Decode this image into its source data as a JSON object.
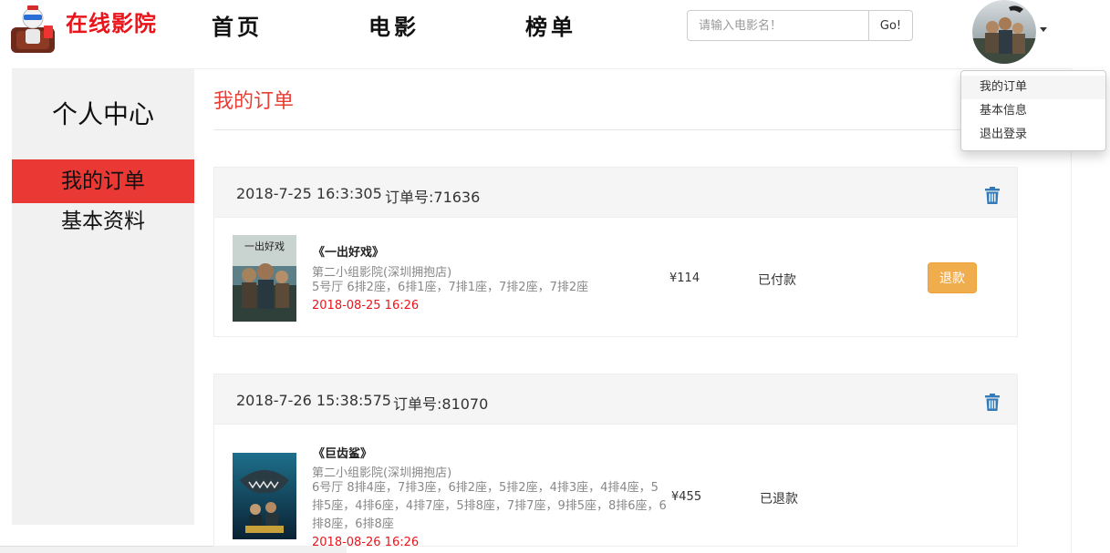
{
  "header": {
    "site_name": "在线影院",
    "nav": [
      "首页",
      "电影",
      "榜单"
    ],
    "search": {
      "placeholder": "请输入电影名！",
      "value": "",
      "button_label": "Go!"
    }
  },
  "user_menu": {
    "items": [
      "我的订单",
      "基本信息",
      "退出登录"
    ],
    "active_index": 0
  },
  "sidebar": {
    "title": "个人中心",
    "items": [
      "我的订单",
      "基本资料"
    ],
    "active_index": 0
  },
  "main": {
    "heading": "我的订单",
    "orders": [
      {
        "created": "2018-7-25 16:3:305",
        "order_no": "订单号:71636",
        "title": "《一出好戏》",
        "cinema": "第二小组影院(深圳拥抱店)",
        "seats": "5号厅 6排2座，6排1座，7排1座，7排2座，7排2座",
        "showtime": "2018-08-25 16:26",
        "price": "¥114",
        "status": "已付款",
        "action_label": "退款"
      },
      {
        "created": "2018-7-26 15:38:575",
        "order_no": "订单号:81070",
        "title": "《巨齿鲨》",
        "cinema": "第二小组影院(深圳拥抱店)",
        "seats": "6号厅 8排4座，7排3座，6排2座，5排2座，4排3座，4排4座，5排5座，4排6座，4排7座，5排8座，7排7座，9排5座，8排6座，6排8座，6排8座",
        "showtime": "2018-08-26 16:26",
        "price": "¥455",
        "status": "已退款"
      }
    ]
  },
  "colors": {
    "brand_red": "#e8151b",
    "sidebar_active": "#ea3834",
    "heading_red": "#e83e35",
    "refund_button": "#f0ad4e",
    "trash_icon": "#337ab7"
  },
  "icons": [
    "user-logo-icon",
    "avatar-image",
    "caret-down-icon",
    "trash-icon",
    "movie-poster"
  ]
}
